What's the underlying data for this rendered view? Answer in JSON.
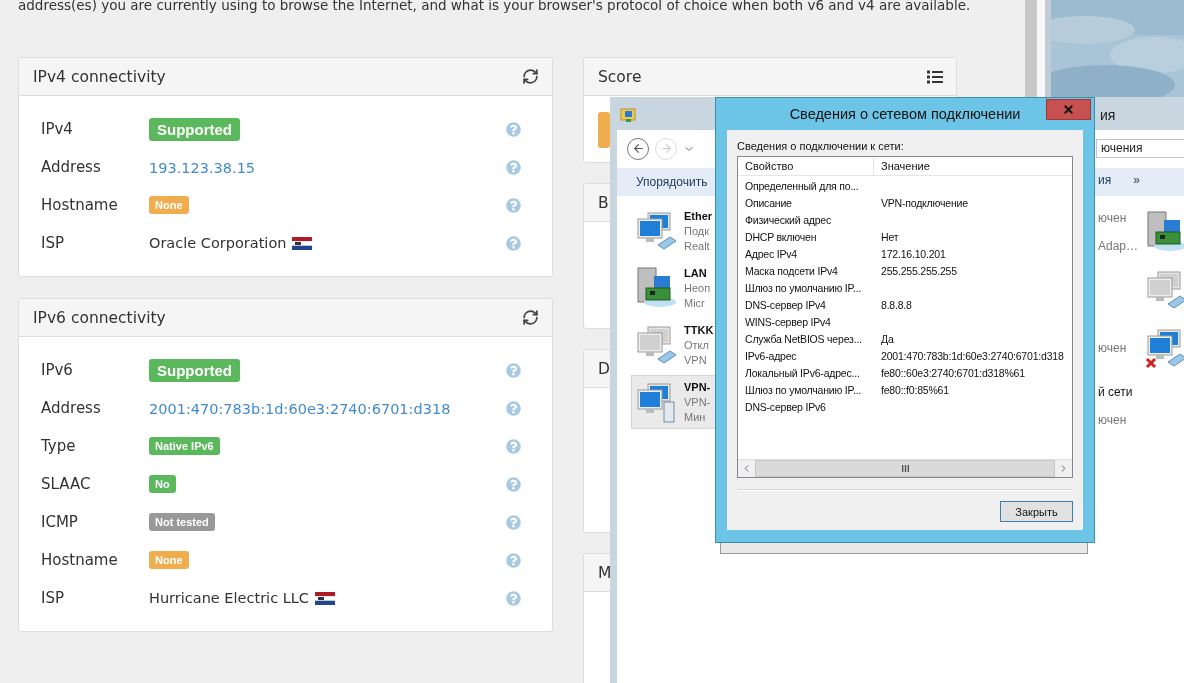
{
  "intro": "address(es) you are currently using to browse the Internet, and what is your browser's protocol of choice when both v6 and v4 are available.",
  "left_cards": [
    {
      "title": "IPv4 connectivity",
      "rows": [
        {
          "label": "IPv4",
          "kind": "badge",
          "value": "Supported",
          "color": "#5cb85c",
          "large": true
        },
        {
          "label": "Address",
          "kind": "link",
          "value": "193.123.38.15"
        },
        {
          "label": "Hostname",
          "kind": "badge",
          "value": "None",
          "color": "#f0ad4e",
          "large": false
        },
        {
          "label": "ISP",
          "kind": "text",
          "value": "Oracle Corporation",
          "flag": true
        }
      ]
    },
    {
      "title": "IPv6 connectivity",
      "rows": [
        {
          "label": "IPv6",
          "kind": "badge",
          "value": "Supported",
          "color": "#5cb85c",
          "large": true
        },
        {
          "label": "Address",
          "kind": "link",
          "value": "2001:470:783b:1d:60e3:2740:6701:d318"
        },
        {
          "label": "Type",
          "kind": "badge",
          "value": "Native IPv6",
          "color": "#5cb85c",
          "large": false
        },
        {
          "label": "SLAAC",
          "kind": "badge",
          "value": "No",
          "color": "#5cb85c",
          "large": false
        },
        {
          "label": "ICMP",
          "kind": "badge",
          "value": "Not tested",
          "color": "#999999",
          "large": false
        },
        {
          "label": "Hostname",
          "kind": "badge",
          "value": "None",
          "color": "#f0ad4e",
          "large": false
        },
        {
          "label": "ISP",
          "kind": "text",
          "value": "Hurricane Electric LLC",
          "flag": true
        }
      ]
    }
  ],
  "right_cards": [
    {
      "title": "Score",
      "kind": "score"
    },
    {
      "title": "B",
      "kind": "list"
    },
    {
      "title": "D",
      "kind": "list"
    },
    {
      "title": "M",
      "kind": "list"
    }
  ],
  "explorer": {
    "title": "ия",
    "address": "ючения",
    "organize": "Упорядочить",
    "command_right": "ия",
    "more": "»",
    "left_items": [
      {
        "kind": "ethernet",
        "selected": false,
        "lines": [
          "Ether",
          "Подк",
          "Realt"
        ]
      },
      {
        "kind": "adapter",
        "selected": false,
        "lines": [
          "LAN",
          "Неоп",
          "Micr"
        ]
      },
      {
        "kind": "disconnected",
        "selected": false,
        "lines": [
          "TTKK",
          "Откл",
          "VPN"
        ]
      },
      {
        "kind": "vpn",
        "selected": true,
        "lines": [
          "VPN-",
          "VPN-",
          "Мин"
        ]
      }
    ],
    "right_items": [
      {
        "kind": "adapter",
        "lines": [
          "ючен",
          "Adap…"
        ]
      },
      {
        "kind": "disconnected"
      },
      {
        "kind": "error",
        "lines": [
          "ючен"
        ]
      },
      {
        "kind": "none",
        "lines": [
          "й сети",
          "ючен"
        ]
      }
    ]
  },
  "dialog": {
    "title": "Сведения о сетевом подключении",
    "group_label": "Сведения о подключении к сети:",
    "columns": [
      "Свойство",
      "Значение"
    ],
    "rows": [
      {
        "property": "Определенный для по..."
      },
      {
        "property": "Описание",
        "value": "VPN-подключение"
      },
      {
        "property": "Физический адрес"
      },
      {
        "property": "DHCP включен",
        "value": "Нет"
      },
      {
        "property": "Адрес IPv4",
        "value": "172.16.10.201"
      },
      {
        "property": "Маска подсети IPv4",
        "value": "255.255.255.255"
      },
      {
        "property": "Шлюз по умолчанию IP..."
      },
      {
        "property": "DNS-сервер IPv4",
        "value": "8.8.8.8"
      },
      {
        "property": "WINS-сервер IPv4"
      },
      {
        "property": "Служба NetBIOS через...",
        "value": "Да"
      },
      {
        "property": "IPv6-адрес",
        "value": "2001:470:783b:1d:60e3:2740:6701:d318"
      },
      {
        "property": "Локальный IPv6-адрес...",
        "value": "fe80::60e3:2740:6701:d318%61"
      },
      {
        "property": "Шлюз по умолчанию IP...",
        "value": "fe80::f0:85%61"
      },
      {
        "property": "DNS-сервер IPv6"
      }
    ],
    "button": "Закрыть"
  }
}
